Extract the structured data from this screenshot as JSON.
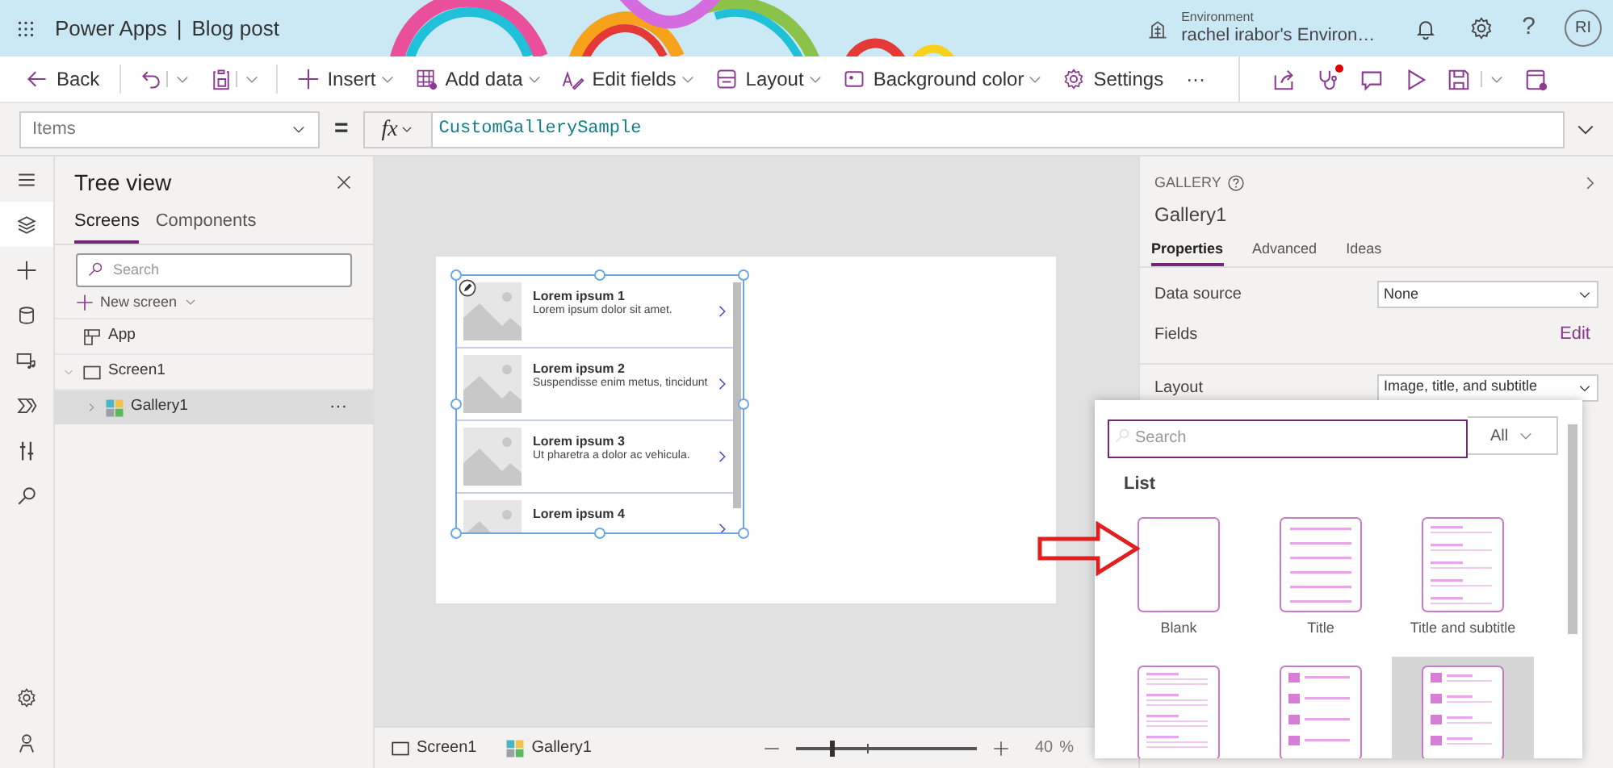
{
  "header": {
    "app": "Power Apps",
    "separator": "|",
    "document": "Blog post",
    "environment_label": "Environment",
    "environment": "rachel irabor's Environ…",
    "help": "?",
    "avatar": "RI"
  },
  "toolbar": {
    "items": [
      {
        "kind": "back",
        "label": "Back",
        "menu": false
      },
      {
        "kind": "undo",
        "menu": true
      },
      {
        "kind": "paste",
        "menu": true
      },
      {
        "kind": "insert",
        "label": "Insert",
        "menu": true
      },
      {
        "kind": "table",
        "label": "Add data",
        "menu": true
      },
      {
        "kind": "fields",
        "label": "Edit fields",
        "menu": true
      },
      {
        "kind": "layout",
        "label": "Layout",
        "menu": true
      },
      {
        "kind": "background",
        "label": "Background color",
        "menu": true
      },
      {
        "kind": "settings",
        "label": "Settings",
        "menu": false
      },
      {
        "kind": "more",
        "label": "···",
        "menu": false
      }
    ],
    "actions": [
      {
        "kind": "share",
        "alert": false
      },
      {
        "kind": "checker",
        "alert": true
      },
      {
        "kind": "comment",
        "alert": false
      },
      {
        "kind": "play",
        "alert": false
      },
      {
        "kind": "save",
        "alert": false,
        "menu": true
      },
      {
        "kind": "publish",
        "alert": false
      }
    ]
  },
  "formula_bar": {
    "property": "Items",
    "equals": "=",
    "fx": "fx",
    "formula": "CustomGallerySample"
  },
  "rail": {
    "top": [
      {
        "kind": "menu",
        "selected": false
      },
      {
        "kind": "layers",
        "selected": true
      },
      {
        "kind": "insert",
        "selected": false
      },
      {
        "kind": "data",
        "selected": false
      },
      {
        "kind": "media",
        "selected": false
      },
      {
        "kind": "flow",
        "selected": false
      },
      {
        "kind": "tools",
        "selected": false
      },
      {
        "kind": "search",
        "selected": false
      }
    ],
    "bottom": [
      {
        "kind": "settings",
        "selected": false
      },
      {
        "kind": "bot",
        "selected": false
      }
    ]
  },
  "tree_view": {
    "title": "Tree view",
    "tabs": [
      {
        "label": "Screens",
        "selected": true
      },
      {
        "label": "Components",
        "selected": false
      }
    ],
    "search": {
      "placeholder": "Search"
    },
    "new_screen": "New screen",
    "nodes": [
      {
        "kind": "app",
        "label": "App",
        "selected": false
      },
      {
        "kind": "screen",
        "label": "Screen1",
        "expanded": true,
        "selected": false,
        "children": [
          {
            "kind": "gallery",
            "label": "Gallery1",
            "expanded": false,
            "selected": true,
            "more": "···"
          }
        ]
      }
    ]
  },
  "gallery": {
    "selected": true,
    "items": [
      {
        "title": "Lorem ipsum 1",
        "subtitle": "Lorem ipsum dolor sit amet."
      },
      {
        "title": "Lorem ipsum 2",
        "subtitle": "Suspendisse enim metus, tincidunt"
      },
      {
        "title": "Lorem ipsum 3",
        "subtitle": "Ut pharetra a dolor ac vehicula."
      },
      {
        "title": "Lorem ipsum 4"
      }
    ]
  },
  "status_bar": {
    "breadcrumbs": [
      {
        "kind": "screen",
        "label": "Screen1"
      },
      {
        "kind": "gallery",
        "label": "Gallery1"
      }
    ],
    "zoom": {
      "level": 0.2,
      "value": "40",
      "unit": "%"
    }
  },
  "properties": {
    "type": "GALLERY",
    "name": "Gallery1",
    "tabs": [
      {
        "label": "Properties",
        "selected": true
      },
      {
        "label": "Advanced",
        "selected": false
      },
      {
        "label": "Ideas",
        "selected": false
      }
    ],
    "rows": [
      {
        "kind": "select",
        "label": "Data source",
        "value": "None"
      },
      {
        "kind": "link",
        "label": "Fields",
        "value": "Edit"
      },
      {
        "kind": "select",
        "label": "Layout",
        "value": "Image, title, and subtitle"
      }
    ]
  },
  "layout_picker": {
    "search": {
      "placeholder": "Search"
    },
    "filter": "All",
    "section": "List",
    "tiles": [
      {
        "kind": "blank",
        "label": "Blank",
        "selected": false
      },
      {
        "kind": "title",
        "label": "Title",
        "selected": false
      },
      {
        "kind": "title-subtitle",
        "label": "Title and subtitle",
        "selected": false
      },
      {
        "kind": "title-subtitle-body",
        "selected": false
      },
      {
        "kind": "image-title",
        "selected": false
      },
      {
        "kind": "image-title-subtitle",
        "selected": true
      }
    ]
  }
}
